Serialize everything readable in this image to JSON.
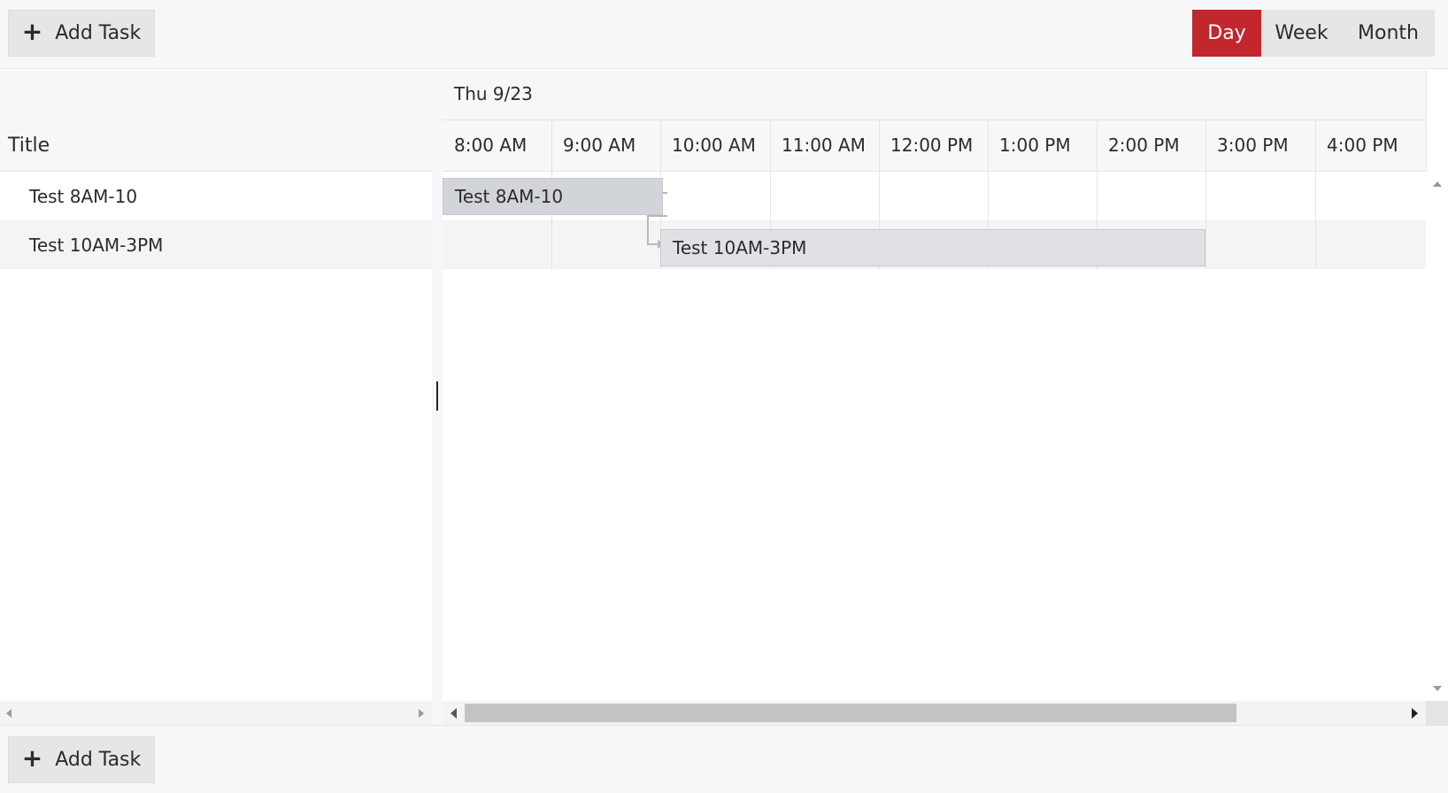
{
  "toolbar_top": {
    "add_task_label": "Add Task"
  },
  "views": [
    {
      "label": "Day",
      "active": true
    },
    {
      "label": "Week",
      "active": false
    },
    {
      "label": "Month",
      "active": false
    }
  ],
  "tree": {
    "column_title": "Title",
    "rows": [
      "Test 8AM-10",
      "Test 10AM-3PM"
    ]
  },
  "timeline": {
    "day_label": "Thu 9/23",
    "slots": [
      "8:00 AM",
      "9:00 AM",
      "10:00 AM",
      "11:00 AM",
      "12:00 PM",
      "1:00 PM",
      "2:00 PM",
      "3:00 PM",
      "4:00 PM"
    ],
    "tasks": [
      {
        "title": "Test 8AM-10",
        "start": "8:00 AM",
        "end": "10:00 AM"
      },
      {
        "title": "Test 10AM-3PM",
        "start": "10:00 AM",
        "end": "3:00 PM"
      }
    ],
    "dependency": {
      "from": "Test 8AM-10",
      "to": "Test 10AM-3PM"
    }
  },
  "toolbar_bottom": {
    "add_task_label": "Add Task"
  },
  "colors": {
    "accent": "#c1272d",
    "task_bar": "#d1d4d9"
  }
}
